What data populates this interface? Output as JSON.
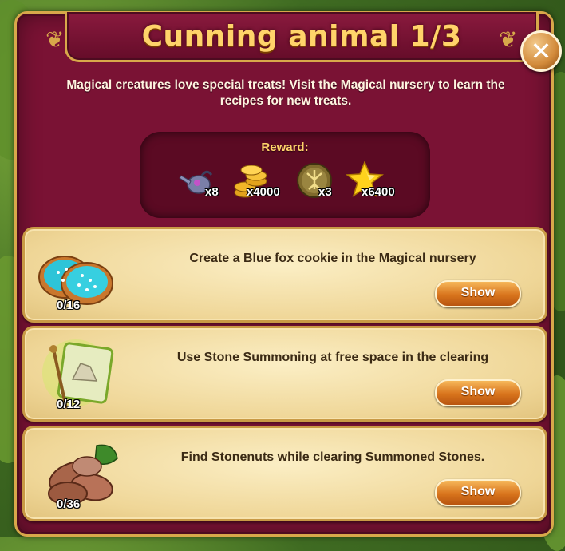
{
  "window": {
    "title": "Cunning animal 1/3",
    "close_label": "✕"
  },
  "description": "Magical creatures love special treats! Visit the Magical nursery to learn the recipes for new treats.",
  "reward": {
    "label": "Reward:",
    "items": [
      {
        "icon": "watering-can-icon",
        "amount": "x8"
      },
      {
        "icon": "gold-coins-icon",
        "amount": "x4000"
      },
      {
        "icon": "rune-medallion-icon",
        "amount": "x3"
      },
      {
        "icon": "star-icon",
        "amount": "x6400"
      }
    ]
  },
  "tasks": [
    {
      "icon": "blue-fox-cookie-icon",
      "text": "Create a Blue fox cookie in the Magical nursery",
      "progress": "0/16",
      "button": "Show"
    },
    {
      "icon": "stone-summoning-scroll-icon",
      "text": "Use Stone Summoning at free space in the clearing",
      "progress": "0/12",
      "button": "Show"
    },
    {
      "icon": "stonenuts-icon",
      "text": "Find Stonenuts while clearing Summoned Stones.",
      "progress": "0/36",
      "button": "Show"
    }
  ],
  "colors": {
    "panel": "#7a1234",
    "gold_text": "#ffd36a",
    "task_bg": "#efd697",
    "button": "#d8741c"
  }
}
